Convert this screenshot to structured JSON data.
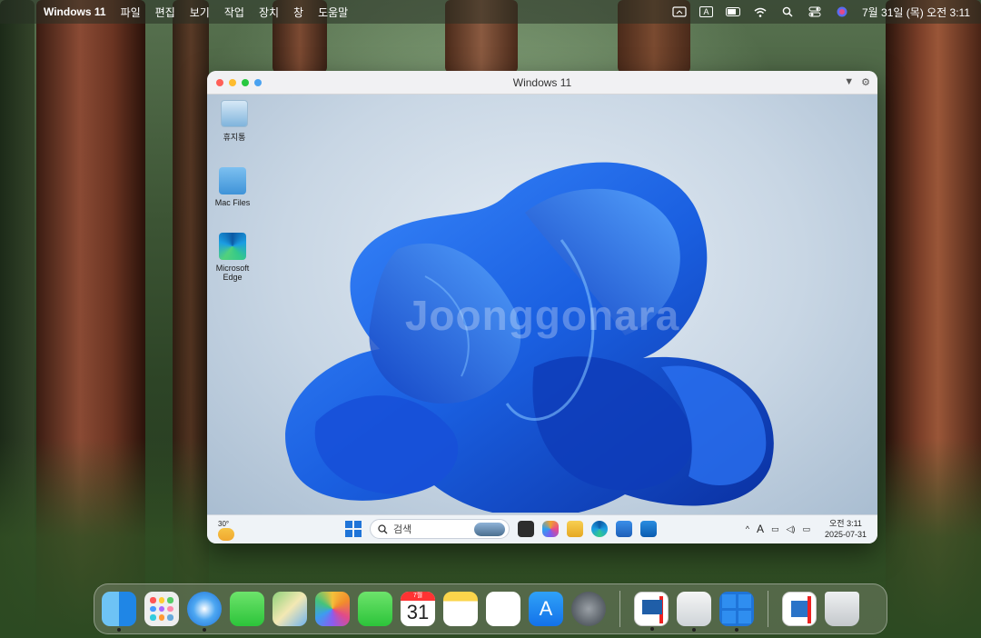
{
  "menubar": {
    "app_name": "Windows 11",
    "items": [
      "파일",
      "편집",
      "보기",
      "작업",
      "장치",
      "창",
      "도움말"
    ],
    "input_indicator": "A",
    "datetime": "7월 31일 (목) 오전 3:11"
  },
  "vm_window": {
    "title": "Windows 11"
  },
  "desktop_icons": [
    {
      "label": "휴지통",
      "icon": "recycle-bin-icon"
    },
    {
      "label": "Mac Files",
      "icon": "mac-folder-icon"
    },
    {
      "label": "Microsoft Edge",
      "icon": "edge-icon"
    }
  ],
  "watermark": "Joonggonara",
  "taskbar": {
    "weather_temp": "30°",
    "search_placeholder": "검색",
    "clock_time": "오전 3:11",
    "clock_date": "2025-07-31",
    "ime": "A"
  },
  "dock": {
    "calendar_month": "7월",
    "calendar_day": "31",
    "apps": [
      "Finder",
      "Launchpad",
      "Safari",
      "Messages",
      "Maps",
      "Photos",
      "FaceTime",
      "Calendar",
      "Notes",
      "Freeform",
      "App Store",
      "System Settings",
      "Parallels Desktop",
      "Clipboard",
      "Windows",
      "Parallels Control Center",
      "Trash"
    ]
  },
  "colors": {
    "menubar_bg": "#28301f",
    "windows_blue": "#1f74d8",
    "bloom_blue": "#1a5fe0"
  }
}
